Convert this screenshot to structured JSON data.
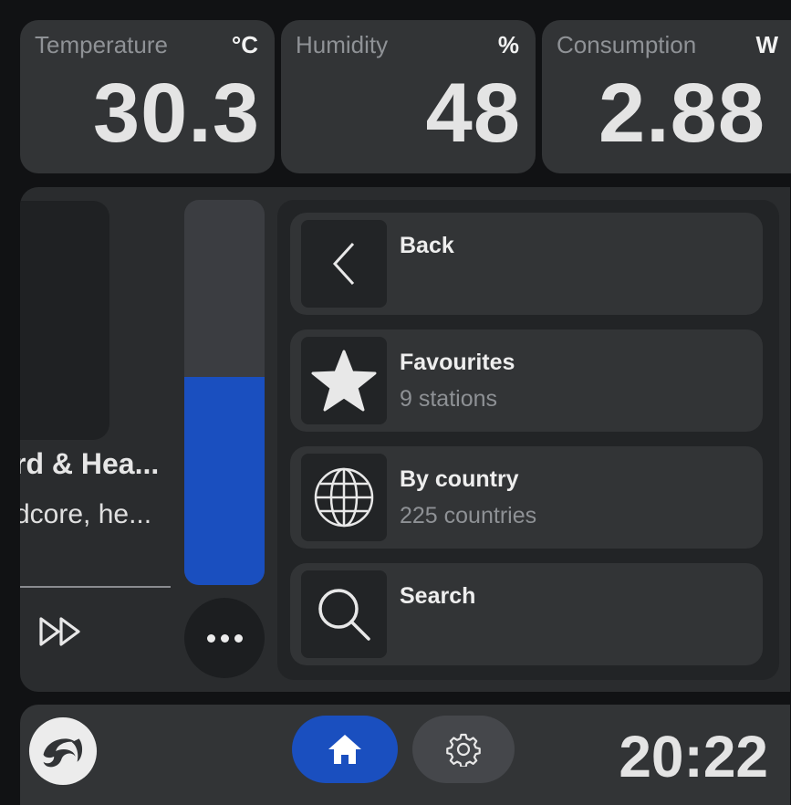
{
  "sensors": [
    {
      "label": "Temperature",
      "unit": "°C",
      "value": "30.3"
    },
    {
      "label": "Humidity",
      "unit": "%",
      "value": "48"
    },
    {
      "label": "Consumption",
      "unit": "W",
      "value": "2.88"
    }
  ],
  "player": {
    "track_title": "rd & Hea...",
    "track_subtitle": "dcore, he...",
    "volume_level": 0.54,
    "forward_icon": "fast-forward-icon",
    "more_icon": "more-dots-icon"
  },
  "menu": {
    "items": [
      {
        "title": "Back",
        "subtitle": "",
        "icon": "chevron-left-icon"
      },
      {
        "title": "Favourites",
        "subtitle": "9 stations",
        "icon": "star-icon"
      },
      {
        "title": "By country",
        "subtitle": "225 countries",
        "icon": "globe-icon"
      },
      {
        "title": "Search",
        "subtitle": "",
        "icon": "search-icon"
      }
    ]
  },
  "bottom_bar": {
    "logo_icon": "app-logo-icon",
    "home_icon": "home-icon",
    "settings_icon": "gear-icon",
    "clock": "20:22"
  },
  "colors": {
    "accent": "#1a4fbf",
    "card": "#323436",
    "background": "#111214"
  }
}
